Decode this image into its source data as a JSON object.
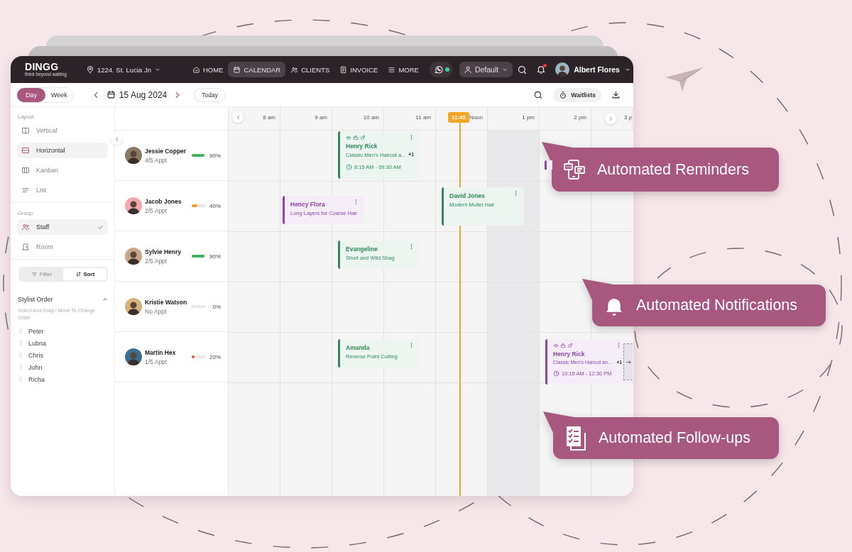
{
  "brand": {
    "name": "DINGG",
    "tagline": "think beyond waiting"
  },
  "location": {
    "label": "1224. St. Lucia Jn"
  },
  "nav": [
    {
      "label": "HOME",
      "kind": "home",
      "selected": false
    },
    {
      "label": "CALENDAR",
      "kind": "calendar",
      "selected": true
    },
    {
      "label": "CLIENTS",
      "kind": "clients",
      "selected": false
    },
    {
      "label": "INVOICE",
      "kind": "invoice",
      "selected": false
    },
    {
      "label": "MORE",
      "kind": "more",
      "selected": false
    }
  ],
  "whatsapp": {
    "online": true
  },
  "view_select": {
    "value": "Default"
  },
  "notifications": {
    "unread": true
  },
  "user": {
    "name": "Albert Flores"
  },
  "view_tabs": [
    {
      "label": "Day",
      "selected": true
    },
    {
      "label": "Week",
      "selected": false
    }
  ],
  "date": {
    "label": "15 Aug 2024"
  },
  "today_button": "Today",
  "waitlists_button": "Waitlists",
  "sidebar": {
    "layout_label": "Layout",
    "layouts": [
      {
        "label": "Vertical",
        "kind": "vertical",
        "selected": false
      },
      {
        "label": "Horizontal",
        "kind": "horizontal",
        "selected": true
      },
      {
        "label": "Kanban",
        "kind": "kanban",
        "selected": false
      },
      {
        "label": "List",
        "kind": "list",
        "selected": false
      }
    ],
    "group_label": "Group",
    "groups": [
      {
        "label": "Staff",
        "kind": "staff",
        "selected": true
      },
      {
        "label": "Room",
        "kind": "room",
        "selected": false
      }
    ],
    "modes": [
      {
        "label": "Filter",
        "kind": "filter",
        "selected": false
      },
      {
        "label": "Sort",
        "kind": "sort",
        "selected": true
      }
    ],
    "order": {
      "title": "Stylist Order",
      "expanded": true,
      "hint": "Select And Drag / Move To Change Order",
      "stylists": [
        "Peter",
        "Lubna",
        "Chris",
        "John",
        "Richa"
      ]
    }
  },
  "timeline": {
    "hours": [
      "8 am",
      "9 am",
      "10 am",
      "11 am",
      "Noon",
      "1 pm",
      "2 pm",
      "3 p"
    ],
    "now": "11:45"
  },
  "staff": [
    {
      "name": "Jessie Copper",
      "appointment_count": "4/5 Appt",
      "level": 0.9,
      "reading": "90%",
      "color": "#3cb55a",
      "bookings": [
        {
          "color": "#2e8b57",
          "show_icons": true,
          "name": "Henry Rick",
          "service": "Classic Men's Haircut a...",
          "extra": "+1",
          "time": "8:15 AM - 09:30 AM"
        },
        {
          "color": "#8e44ad"
        }
      ]
    },
    {
      "name": "Jacob Jones",
      "appointment_count": "2/5 Appt",
      "level": 0.4,
      "reading": "40%",
      "color": "#f0a020",
      "bookings": [
        {
          "color": "#8e44ad",
          "name": "Hency Flora",
          "service": "Long Layers for Coarse Hair"
        },
        {
          "color": "#2e8b57",
          "name": "David Jones",
          "service": "Modern Mullet Hair"
        }
      ]
    },
    {
      "name": "Sylvie Henry",
      "appointment_count": "2/5 Appt",
      "level": 0.9,
      "reading": "90%",
      "color": "#3cb55a",
      "bookings": [
        {
          "color": "#2e8b57",
          "name": "Evangeline",
          "service": "Short and Wild Shag"
        }
      ]
    },
    {
      "name": "Kristie Watson",
      "appointment_count": "No Appt",
      "level": 0,
      "reading": "0%"
    },
    {
      "name": "Martin Hex",
      "appointment_count": "1/5 Appt",
      "level": 0.2,
      "reading": "20%",
      "color": "#e5533d",
      "bookings": [
        {
          "color": "#2e8b57",
          "name": "Amanda",
          "service": "Reverse Point Cutting"
        },
        {
          "color": "#8e44ad",
          "show_icons": true,
          "drag_handle": true,
          "name": "Henry Rick",
          "service": "Classic Men's Haircut an...",
          "extra": "+1",
          "time": "10:15 AM - 12:30 PM"
        }
      ]
    }
  ],
  "callouts": [
    {
      "label": "Automated Reminders",
      "kind": "reminders"
    },
    {
      "label": "Automated Notifications",
      "kind": "notifications"
    },
    {
      "label": "Automated Follow-ups",
      "kind": "followups"
    }
  ]
}
